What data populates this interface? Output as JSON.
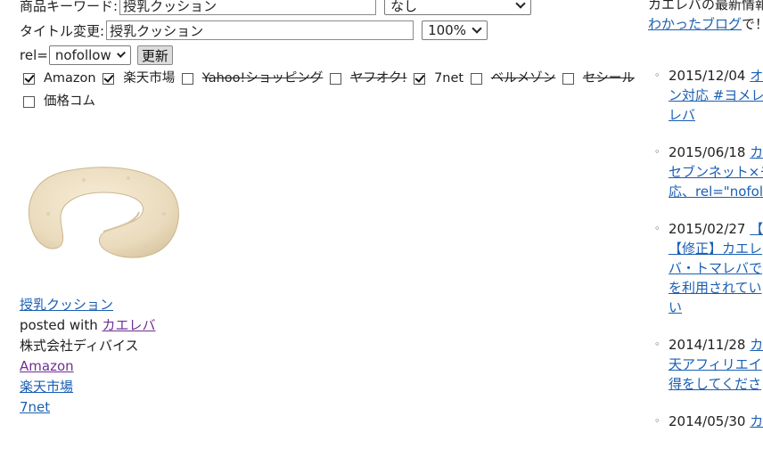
{
  "form": {
    "keyword_label": "商品キーワード:",
    "keyword_value": "授乳クッション",
    "category_select": "なし",
    "title_label": "タイトル変更:",
    "title_value": "授乳クッション",
    "size_select": "100%",
    "rel_label": "rel=",
    "rel_select": "nofollow",
    "update_button": "更新"
  },
  "shops": [
    {
      "label": "Amazon",
      "checked": true
    },
    {
      "label": "楽天市場",
      "checked": true
    },
    {
      "label": "Yahoo!ショッピング",
      "checked": false
    },
    {
      "label": "ヤフオク!",
      "checked": false
    },
    {
      "label": "7net",
      "checked": true
    },
    {
      "label": "ベルメゾン",
      "checked": false
    },
    {
      "label": "セシール",
      "checked": false
    },
    {
      "label": "価格コム",
      "checked": false
    }
  ],
  "product": {
    "title_link": "授乳クッション",
    "posted_with_prefix": "posted with ",
    "posted_with_link": "カエレバ",
    "maker": "株式会社ディバイス",
    "links": [
      "Amazon",
      "楽天市場",
      "7net"
    ]
  },
  "sidebar": {
    "heading": "カエレバの最新情報",
    "sub_link": "わかったブログ",
    "sub_suffix": "で！",
    "posts": [
      {
        "date": "2015/12/04",
        "lines": [
          "オ",
          "ン対応 #ヨメレ",
          "レバ"
        ]
      },
      {
        "date": "2015/06/18",
        "lines": [
          "カ",
          "セブンネット×モ",
          "応、rel=\"nofoll"
        ]
      },
      {
        "date": "2015/02/27",
        "lines": [
          "【",
          "【修正】カエレ",
          "バ・トマレバで",
          "を利用されてい",
          "い"
        ]
      },
      {
        "date": "2014/11/28",
        "lines": [
          "カ",
          "天アフィリエイ",
          "得をしてくださ"
        ]
      },
      {
        "date": "2014/05/30",
        "lines": [
          "カ"
        ]
      }
    ]
  },
  "colors": {
    "link": "#1a5fb4",
    "visited": "#6f2f91",
    "cushion": "#eee0c4"
  }
}
